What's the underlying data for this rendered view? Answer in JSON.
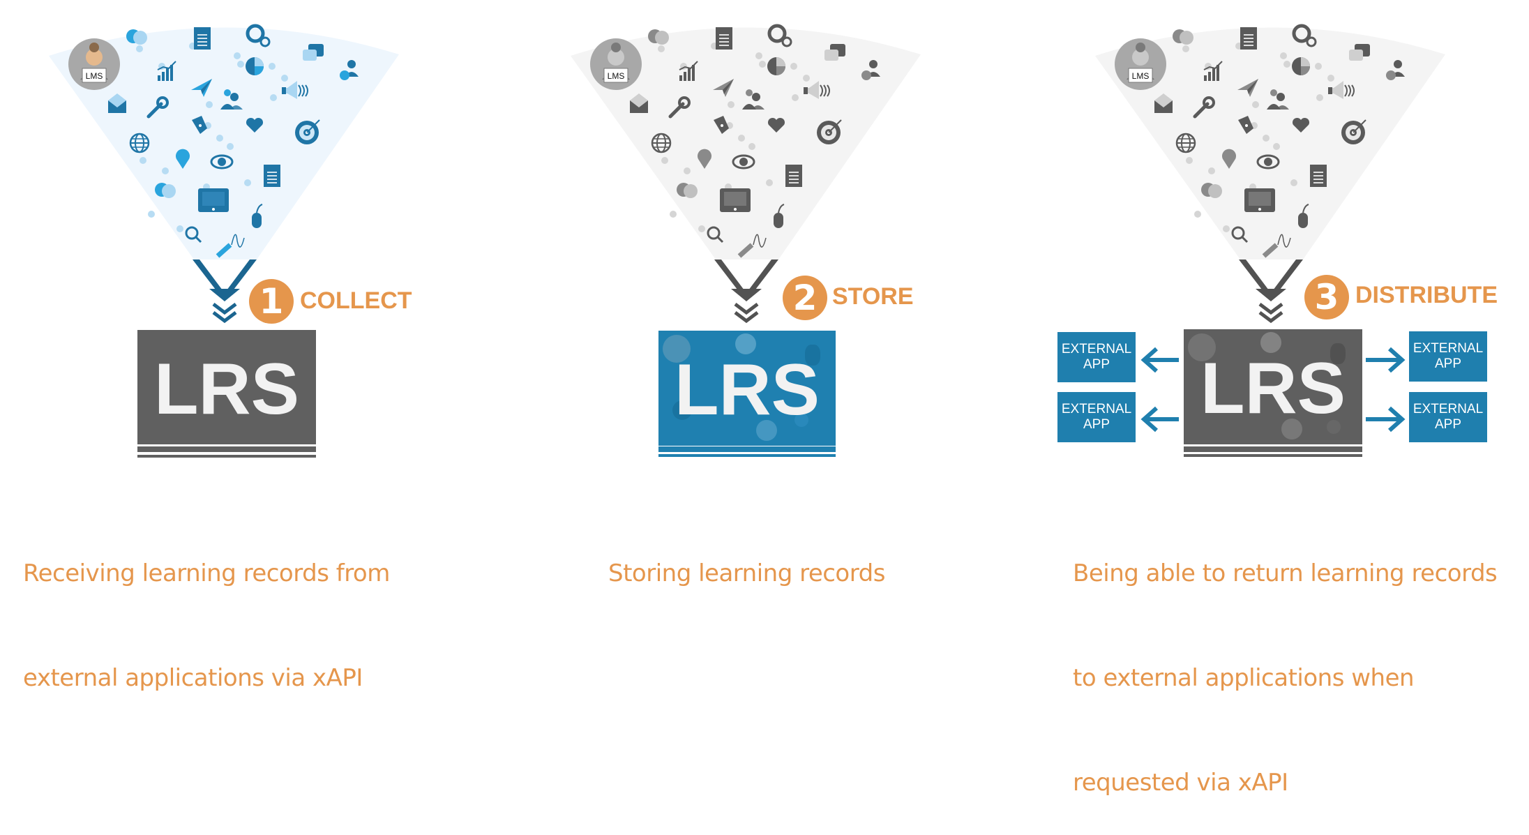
{
  "colors": {
    "accent_orange": "#e5964c",
    "brand_blue": "#1f7fae",
    "lrs_gray": "#606060",
    "funnel_blue_bg": "#eef6fd",
    "funnel_gray_bg": "#f4f4f4",
    "icon_blue": "#1f75a6",
    "icon_gray": "#5a5a5a"
  },
  "steps": [
    {
      "number": "1",
      "label": "COLLECT",
      "box_label": "LRS",
      "avatar_label": "LMS",
      "description_lines": [
        "Receiving learning records from",
        "external applications via xAPI"
      ],
      "funnel_style": "blue",
      "box_style": "gray"
    },
    {
      "number": "2",
      "label": "STORE",
      "box_label": "LRS",
      "avatar_label": "LMS",
      "description_lines": [
        "Storing learning records"
      ],
      "funnel_style": "gray",
      "box_style": "blue"
    },
    {
      "number": "3",
      "label": "DISTRIBUTE",
      "box_label": "LRS",
      "avatar_label": "LMS",
      "description_lines": [
        "Being able to return learning records",
        "to external applications when",
        "requested via xAPI"
      ],
      "funnel_style": "gray",
      "box_style": "dark"
    }
  ],
  "external_apps": {
    "line1": "EXTERNAL",
    "line2": "APP",
    "left_count": 2,
    "right_count": 2
  },
  "funnel_icons": [
    "lms-avatar-icon",
    "chat-bubbles-icon",
    "document-icon",
    "gears-icon",
    "chat-icon",
    "add-user-icon",
    "bar-chart-icon",
    "pie-chart-icon",
    "paper-plane-icon",
    "megaphone-icon",
    "envelope-icon",
    "wrench-icon",
    "users-icon",
    "pen-nib-icon",
    "heart-icon",
    "target-icon",
    "globe-icon",
    "map-pin-icon",
    "eye-icon",
    "document-icon",
    "chat-bubbles-icon",
    "tablet-icon",
    "mouse-icon",
    "search-icon",
    "pencil-icon"
  ]
}
